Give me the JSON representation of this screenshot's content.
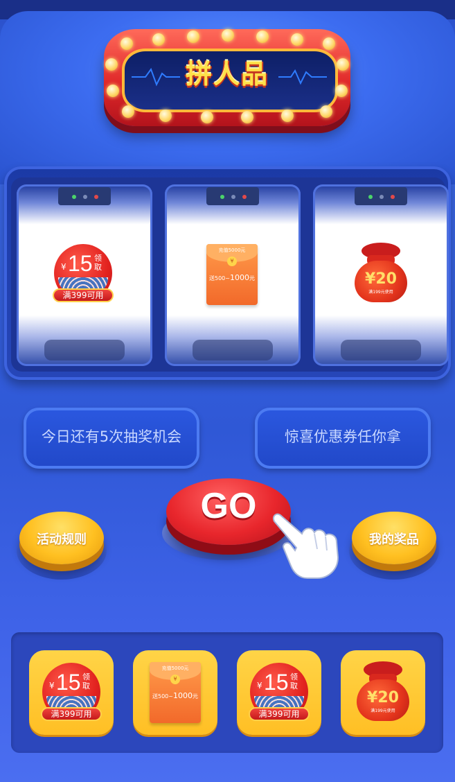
{
  "sign": {
    "title": "拼人品"
  },
  "reels": [
    {
      "type": "coupon",
      "yen": "¥",
      "amount": "15",
      "get": "领取",
      "condition": "满399可用"
    },
    {
      "type": "envelope",
      "top_text": "充值5000元",
      "coin": "¥",
      "line_a": "送500",
      "tilde": "~",
      "line_b": "1000",
      "unit": "元"
    },
    {
      "type": "bag",
      "amount": "¥20",
      "condition": "满199元使用"
    }
  ],
  "info": {
    "chances": "今日还有5次抽奖机会",
    "slogan": "惊喜优惠券任你拿"
  },
  "buttons": {
    "rules": "活动规则",
    "go": "GO",
    "my_prizes": "我的奖品"
  },
  "prizes": [
    {
      "type": "coupon",
      "yen": "¥",
      "amount": "15",
      "get": "领取",
      "condition": "满399可用"
    },
    {
      "type": "envelope",
      "top_text": "充值5000元",
      "coin": "¥",
      "line_a": "送500",
      "tilde": "~",
      "line_b": "1000",
      "unit": "元"
    },
    {
      "type": "coupon",
      "yen": "¥",
      "amount": "15",
      "get": "领取",
      "condition": "满399可用"
    },
    {
      "type": "bag",
      "amount": "¥20",
      "condition": "满199元使用"
    }
  ],
  "colors": {
    "accent_red": "#e2221f",
    "gold": "#ffc021",
    "cabinet_blue": "#2f58d6"
  }
}
